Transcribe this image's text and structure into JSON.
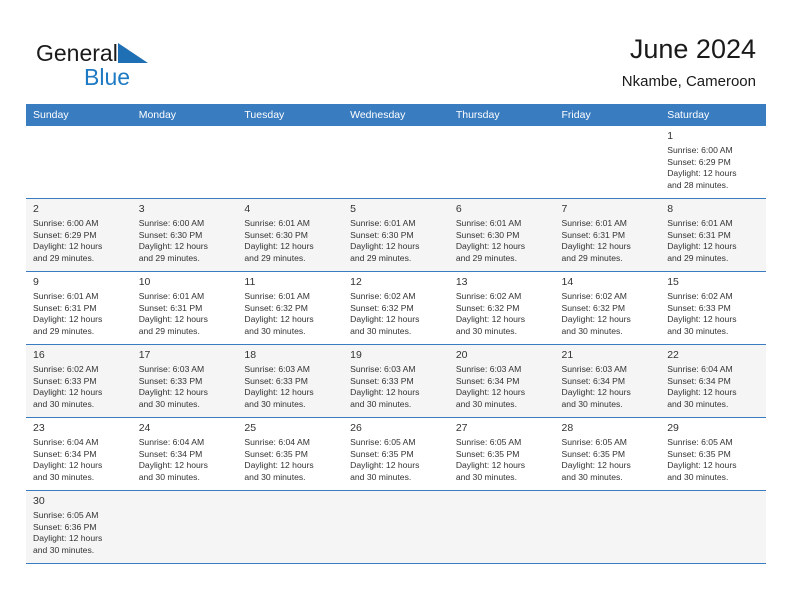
{
  "brand": {
    "name_top": "General",
    "name_bottom": "Blue",
    "triangle_color": "#1f6fb4",
    "blue_color": "#1f7ac4"
  },
  "header": {
    "title": "June 2024",
    "subtitle": "Nkambe, Cameroon"
  },
  "theme": {
    "header_row_bg": "#3a7cc0",
    "header_row_text": "#ffffff",
    "alt_row_bg": "#f5f5f5",
    "row_border": "#3a7cc0"
  },
  "columns": [
    "Sunday",
    "Monday",
    "Tuesday",
    "Wednesday",
    "Thursday",
    "Friday",
    "Saturday"
  ],
  "weeks": [
    [
      {
        "empty": true
      },
      {
        "empty": true
      },
      {
        "empty": true
      },
      {
        "empty": true
      },
      {
        "empty": true
      },
      {
        "empty": true
      },
      {
        "day": "1",
        "sunrise": "Sunrise: 6:00 AM",
        "sunset": "Sunset: 6:29 PM",
        "daylight1": "Daylight: 12 hours",
        "daylight2": "and 28 minutes."
      }
    ],
    [
      {
        "day": "2",
        "sunrise": "Sunrise: 6:00 AM",
        "sunset": "Sunset: 6:29 PM",
        "daylight1": "Daylight: 12 hours",
        "daylight2": "and 29 minutes."
      },
      {
        "day": "3",
        "sunrise": "Sunrise: 6:00 AM",
        "sunset": "Sunset: 6:30 PM",
        "daylight1": "Daylight: 12 hours",
        "daylight2": "and 29 minutes."
      },
      {
        "day": "4",
        "sunrise": "Sunrise: 6:01 AM",
        "sunset": "Sunset: 6:30 PM",
        "daylight1": "Daylight: 12 hours",
        "daylight2": "and 29 minutes."
      },
      {
        "day": "5",
        "sunrise": "Sunrise: 6:01 AM",
        "sunset": "Sunset: 6:30 PM",
        "daylight1": "Daylight: 12 hours",
        "daylight2": "and 29 minutes."
      },
      {
        "day": "6",
        "sunrise": "Sunrise: 6:01 AM",
        "sunset": "Sunset: 6:30 PM",
        "daylight1": "Daylight: 12 hours",
        "daylight2": "and 29 minutes."
      },
      {
        "day": "7",
        "sunrise": "Sunrise: 6:01 AM",
        "sunset": "Sunset: 6:31 PM",
        "daylight1": "Daylight: 12 hours",
        "daylight2": "and 29 minutes."
      },
      {
        "day": "8",
        "sunrise": "Sunrise: 6:01 AM",
        "sunset": "Sunset: 6:31 PM",
        "daylight1": "Daylight: 12 hours",
        "daylight2": "and 29 minutes."
      }
    ],
    [
      {
        "day": "9",
        "sunrise": "Sunrise: 6:01 AM",
        "sunset": "Sunset: 6:31 PM",
        "daylight1": "Daylight: 12 hours",
        "daylight2": "and 29 minutes."
      },
      {
        "day": "10",
        "sunrise": "Sunrise: 6:01 AM",
        "sunset": "Sunset: 6:31 PM",
        "daylight1": "Daylight: 12 hours",
        "daylight2": "and 29 minutes."
      },
      {
        "day": "11",
        "sunrise": "Sunrise: 6:01 AM",
        "sunset": "Sunset: 6:32 PM",
        "daylight1": "Daylight: 12 hours",
        "daylight2": "and 30 minutes."
      },
      {
        "day": "12",
        "sunrise": "Sunrise: 6:02 AM",
        "sunset": "Sunset: 6:32 PM",
        "daylight1": "Daylight: 12 hours",
        "daylight2": "and 30 minutes."
      },
      {
        "day": "13",
        "sunrise": "Sunrise: 6:02 AM",
        "sunset": "Sunset: 6:32 PM",
        "daylight1": "Daylight: 12 hours",
        "daylight2": "and 30 minutes."
      },
      {
        "day": "14",
        "sunrise": "Sunrise: 6:02 AM",
        "sunset": "Sunset: 6:32 PM",
        "daylight1": "Daylight: 12 hours",
        "daylight2": "and 30 minutes."
      },
      {
        "day": "15",
        "sunrise": "Sunrise: 6:02 AM",
        "sunset": "Sunset: 6:33 PM",
        "daylight1": "Daylight: 12 hours",
        "daylight2": "and 30 minutes."
      }
    ],
    [
      {
        "day": "16",
        "sunrise": "Sunrise: 6:02 AM",
        "sunset": "Sunset: 6:33 PM",
        "daylight1": "Daylight: 12 hours",
        "daylight2": "and 30 minutes."
      },
      {
        "day": "17",
        "sunrise": "Sunrise: 6:03 AM",
        "sunset": "Sunset: 6:33 PM",
        "daylight1": "Daylight: 12 hours",
        "daylight2": "and 30 minutes."
      },
      {
        "day": "18",
        "sunrise": "Sunrise: 6:03 AM",
        "sunset": "Sunset: 6:33 PM",
        "daylight1": "Daylight: 12 hours",
        "daylight2": "and 30 minutes."
      },
      {
        "day": "19",
        "sunrise": "Sunrise: 6:03 AM",
        "sunset": "Sunset: 6:33 PM",
        "daylight1": "Daylight: 12 hours",
        "daylight2": "and 30 minutes."
      },
      {
        "day": "20",
        "sunrise": "Sunrise: 6:03 AM",
        "sunset": "Sunset: 6:34 PM",
        "daylight1": "Daylight: 12 hours",
        "daylight2": "and 30 minutes."
      },
      {
        "day": "21",
        "sunrise": "Sunrise: 6:03 AM",
        "sunset": "Sunset: 6:34 PM",
        "daylight1": "Daylight: 12 hours",
        "daylight2": "and 30 minutes."
      },
      {
        "day": "22",
        "sunrise": "Sunrise: 6:04 AM",
        "sunset": "Sunset: 6:34 PM",
        "daylight1": "Daylight: 12 hours",
        "daylight2": "and 30 minutes."
      }
    ],
    [
      {
        "day": "23",
        "sunrise": "Sunrise: 6:04 AM",
        "sunset": "Sunset: 6:34 PM",
        "daylight1": "Daylight: 12 hours",
        "daylight2": "and 30 minutes."
      },
      {
        "day": "24",
        "sunrise": "Sunrise: 6:04 AM",
        "sunset": "Sunset: 6:34 PM",
        "daylight1": "Daylight: 12 hours",
        "daylight2": "and 30 minutes."
      },
      {
        "day": "25",
        "sunrise": "Sunrise: 6:04 AM",
        "sunset": "Sunset: 6:35 PM",
        "daylight1": "Daylight: 12 hours",
        "daylight2": "and 30 minutes."
      },
      {
        "day": "26",
        "sunrise": "Sunrise: 6:05 AM",
        "sunset": "Sunset: 6:35 PM",
        "daylight1": "Daylight: 12 hours",
        "daylight2": "and 30 minutes."
      },
      {
        "day": "27",
        "sunrise": "Sunrise: 6:05 AM",
        "sunset": "Sunset: 6:35 PM",
        "daylight1": "Daylight: 12 hours",
        "daylight2": "and 30 minutes."
      },
      {
        "day": "28",
        "sunrise": "Sunrise: 6:05 AM",
        "sunset": "Sunset: 6:35 PM",
        "daylight1": "Daylight: 12 hours",
        "daylight2": "and 30 minutes."
      },
      {
        "day": "29",
        "sunrise": "Sunrise: 6:05 AM",
        "sunset": "Sunset: 6:35 PM",
        "daylight1": "Daylight: 12 hours",
        "daylight2": "and 30 minutes."
      }
    ],
    [
      {
        "day": "30",
        "sunrise": "Sunrise: 6:05 AM",
        "sunset": "Sunset: 6:36 PM",
        "daylight1": "Daylight: 12 hours",
        "daylight2": "and 30 minutes."
      },
      {
        "empty": true
      },
      {
        "empty": true
      },
      {
        "empty": true
      },
      {
        "empty": true
      },
      {
        "empty": true
      },
      {
        "empty": true
      }
    ]
  ]
}
